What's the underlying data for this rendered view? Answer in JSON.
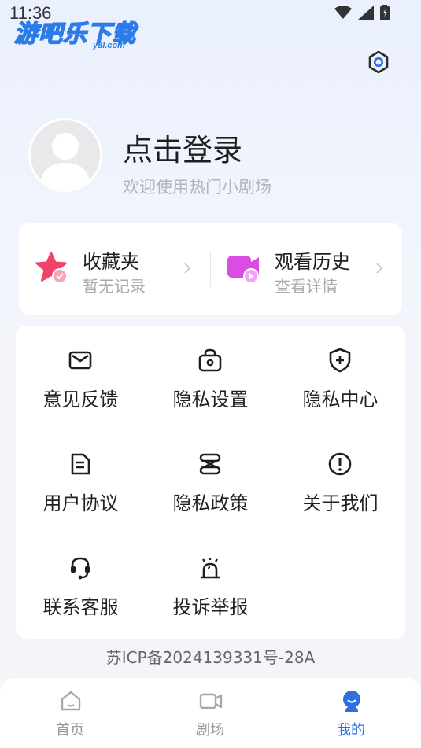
{
  "status_bar": {
    "time": "11:36"
  },
  "watermark": {
    "text": "游吧乐下载",
    "sub": "y8l.com"
  },
  "profile": {
    "login_title": "点击登录",
    "welcome": "欢迎使用热门小剧场"
  },
  "quick_links": [
    {
      "title": "收藏夹",
      "subtitle": "暂无记录",
      "icon": "star-icon",
      "color": "#f0426a"
    },
    {
      "title": "观看历史",
      "subtitle": "查看详情",
      "icon": "video-history-icon",
      "color": "#d94ee0"
    }
  ],
  "grid": [
    {
      "label": "意见反馈",
      "icon": "mail-icon"
    },
    {
      "label": "隐私设置",
      "icon": "lock-bag-icon"
    },
    {
      "label": "隐私中心",
      "icon": "shield-plus-icon"
    },
    {
      "label": "用户协议",
      "icon": "document-icon"
    },
    {
      "label": "隐私政策",
      "icon": "policy-icon"
    },
    {
      "label": "关于我们",
      "icon": "info-icon"
    },
    {
      "label": "联系客服",
      "icon": "headset-icon"
    },
    {
      "label": "投诉举报",
      "icon": "alarm-icon"
    }
  ],
  "icp": "苏ICP备2024139331号-28A",
  "tabbar": [
    {
      "label": "首页",
      "icon": "home-icon",
      "active": false
    },
    {
      "label": "剧场",
      "icon": "video-camera-icon",
      "active": false
    },
    {
      "label": "我的",
      "icon": "profile-icon",
      "active": true
    }
  ],
  "colors": {
    "accent": "#2f6fe0",
    "star": "#f0426a",
    "video": "#d94ee0"
  }
}
